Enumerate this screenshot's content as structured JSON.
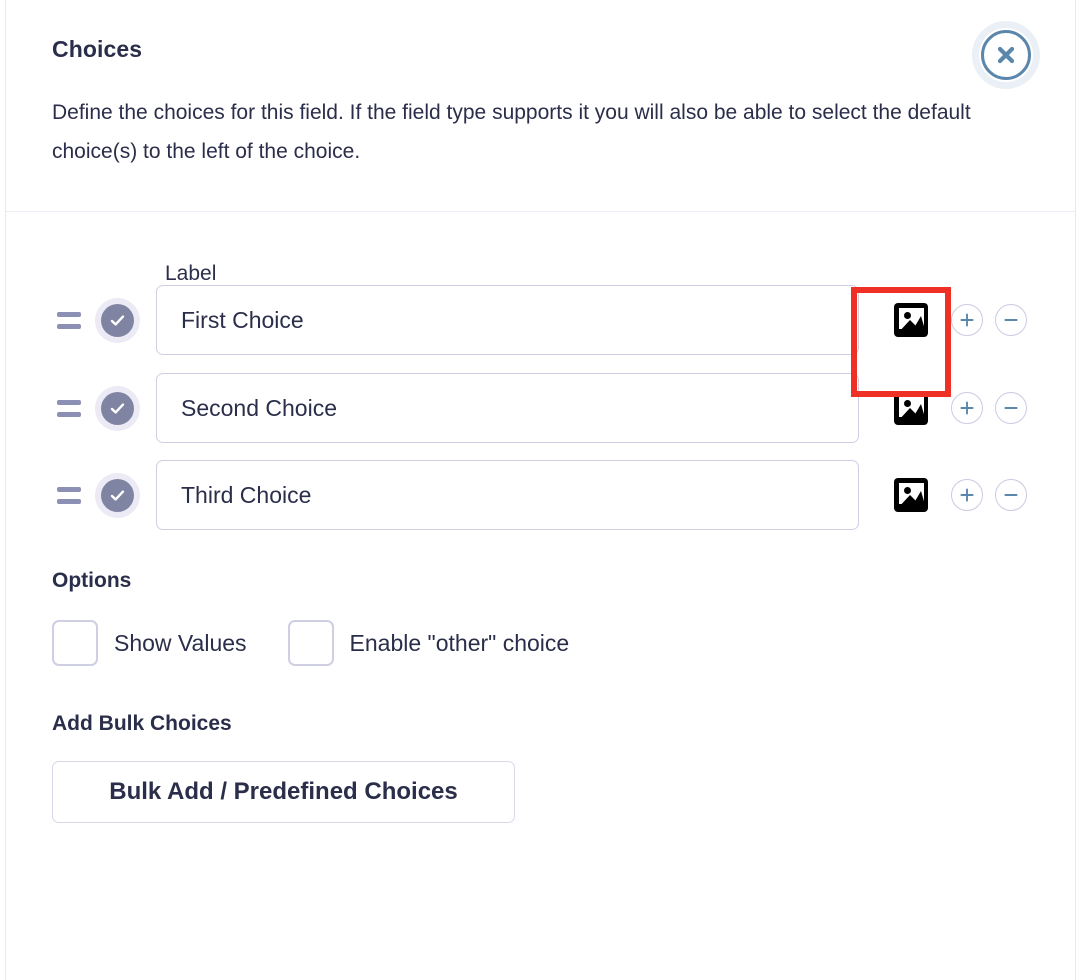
{
  "header": {
    "title": "Choices",
    "description": "Define the choices for this field. If the field type supports it you will also be able to select the default choice(s) to the left of the choice.",
    "close_label": "close-icon"
  },
  "choices_section": {
    "column_header": "Label",
    "rows": [
      {
        "value": "First Choice",
        "checked": true,
        "drag": "drag-handle",
        "image": "image-icon",
        "add": "+",
        "remove": "−"
      },
      {
        "value": "Second Choice",
        "checked": true,
        "drag": "drag-handle",
        "image": "image-icon",
        "add": "+",
        "remove": "−"
      },
      {
        "value": "Third Choice",
        "checked": true,
        "drag": "drag-handle",
        "image": "image-icon",
        "add": "+",
        "remove": "−"
      }
    ]
  },
  "options": {
    "title": "Options",
    "items": [
      {
        "label": "Show Values",
        "checked": false
      },
      {
        "label": "Enable \"other\" choice",
        "checked": false
      }
    ]
  },
  "bulk": {
    "title": "Add Bulk Choices",
    "button_label": "Bulk Add / Predefined Choices"
  },
  "annotation": {
    "type": "highlight-box",
    "color": "#ee3124",
    "target": "image-icon-row-1"
  },
  "colors": {
    "text": "#2b2e4a",
    "border": "#cfcfe4",
    "checkbox_fill": "#7f84a3",
    "checkbox_halo": "#eceaf4",
    "close_accent": "#5b87ad",
    "highlight": "#ee3124"
  }
}
